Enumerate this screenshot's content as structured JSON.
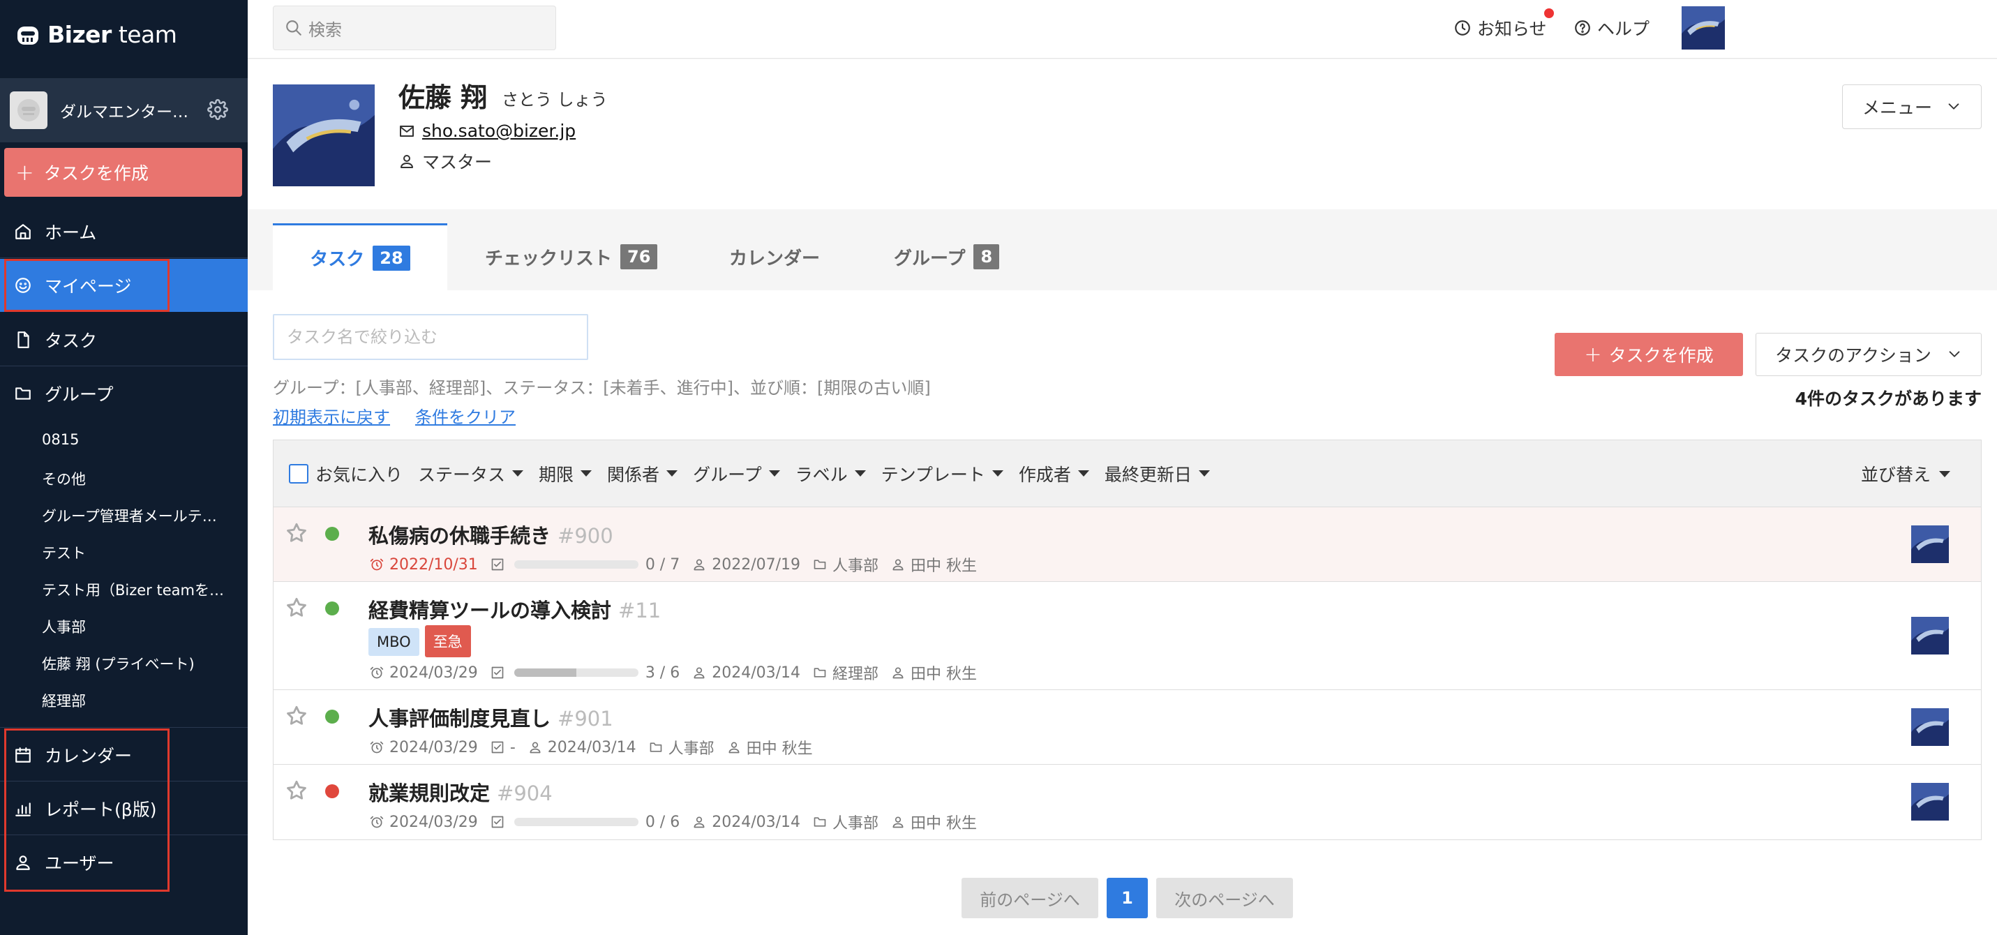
{
  "brand": {
    "name_bold": "Bizer",
    "name_light": " team"
  },
  "org": {
    "name": "ダルマエンター…"
  },
  "sidebar": {
    "create_label": "タスクを作成",
    "nav": [
      {
        "label": "ホーム"
      },
      {
        "label": "マイページ"
      },
      {
        "label": "タスク"
      },
      {
        "label": "グループ"
      },
      {
        "label": "カレンダー"
      },
      {
        "label": "レポート(β版)"
      },
      {
        "label": "ユーザー"
      }
    ],
    "groups": [
      "0815",
      "その他",
      "グループ管理者メールテ…",
      "テスト",
      "テスト用（Bizer teamを…",
      "人事部",
      "佐藤 翔 (プライベート)",
      "経理部"
    ]
  },
  "topbar": {
    "search_placeholder": "検索",
    "notice": "お知らせ",
    "help": "ヘルプ"
  },
  "profile": {
    "name": "佐藤 翔",
    "kana": "さとう しょう",
    "email": "sho.sato@bizer.jp",
    "role": "マスター",
    "menu": "メニュー"
  },
  "tabs": [
    {
      "label": "タスク",
      "count": "28"
    },
    {
      "label": "チェックリスト",
      "count": "76"
    },
    {
      "label": "カレンダー",
      "count": ""
    },
    {
      "label": "グループ",
      "count": "8"
    }
  ],
  "filter": {
    "placeholder": "タスク名で絞り込む",
    "desc": "グループ：[人事部、経理部]、ステータス：[未着手、進行中]、並び順：[期限の古い順]",
    "reset": "初期表示に戻す",
    "clear": "条件をクリア"
  },
  "actions": {
    "create": "タスクを作成",
    "task_action": "タスクのアクション",
    "count_text": "4件のタスクがあります"
  },
  "table": {
    "headers": [
      "お気に入り",
      "ステータス",
      "期限",
      "関係者",
      "グループ",
      "ラベル",
      "テンプレート",
      "作成者",
      "最終更新日"
    ],
    "sort": "並び替え",
    "rows": [
      {
        "title": "私傷病の休職手続き",
        "num": "#900",
        "status_color": "#5cae4c",
        "due": "2022/10/31",
        "due_overdue": true,
        "progress": "0 / 7",
        "progress_fraction": 0,
        "created": "2022/07/19",
        "group": "人事部",
        "owner": "田中 秋生",
        "labels": []
      },
      {
        "title": "経費精算ツールの導入検討",
        "num": "#11",
        "status_color": "#5cae4c",
        "due": "2024/03/29",
        "due_overdue": false,
        "progress": "3 / 6",
        "progress_fraction": 0.5,
        "created": "2024/03/14",
        "group": "経理部",
        "owner": "田中 秋生",
        "labels": [
          {
            "text": "MBO",
            "bg": "#cfe3f8",
            "fg": "#222"
          },
          {
            "text": "至急",
            "bg": "#e05a4f",
            "fg": "#ffffff"
          }
        ]
      },
      {
        "title": "人事評価制度見直し",
        "num": "#901",
        "status_color": "#5cae4c",
        "due": "2024/03/29",
        "due_overdue": false,
        "progress": "-",
        "progress_fraction": null,
        "created": "2024/03/14",
        "group": "人事部",
        "owner": "田中 秋生",
        "labels": []
      },
      {
        "title": "就業規則改定",
        "num": "#904",
        "status_color": "#e0473c",
        "due": "2024/03/29",
        "due_overdue": false,
        "progress": "0 / 6",
        "progress_fraction": 0,
        "created": "2024/03/14",
        "group": "人事部",
        "owner": "田中 秋生",
        "labels": []
      }
    ]
  },
  "pager": {
    "prev": "前のページへ",
    "current": "1",
    "next": "次のページへ"
  },
  "colors": {
    "sidebar_bg": "#0f1c2e",
    "accent": "#2f7be0",
    "create": "#e9746f",
    "highlight_box": "#e0392d"
  }
}
